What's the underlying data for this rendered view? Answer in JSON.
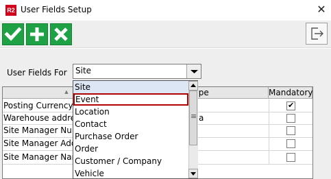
{
  "window": {
    "app_icon_text": "R2",
    "title": "User Fields Setup",
    "close_glyph": "✕"
  },
  "toolbar": {
    "buttons": [
      {
        "name": "save",
        "icon": "check-icon"
      },
      {
        "name": "add",
        "icon": "plus-icon"
      },
      {
        "name": "delete",
        "icon": "x-icon"
      }
    ],
    "exit_icon": "exit-icon"
  },
  "filter": {
    "label": "User Fields For",
    "selected": "Site"
  },
  "table": {
    "headers": {
      "name": "",
      "type": "Type",
      "mandatory": "Mandatory"
    },
    "sort_indicator": "▲",
    "rows": [
      {
        "name": "Posting Currency",
        "type": "",
        "mandatory": true
      },
      {
        "name": "Warehouse address",
        "type": "a",
        "mandatory": false
      },
      {
        "name": "Site Manager Num",
        "type": "",
        "mandatory": false
      },
      {
        "name": "Site Manager Addr",
        "type": "",
        "mandatory": false
      },
      {
        "name": "Site Manager Nam",
        "type": "",
        "mandatory": false
      }
    ]
  },
  "dropdown": {
    "options": [
      "Site",
      "Event",
      "Location",
      "Contact",
      "Purchase Order",
      "Order",
      "Customer / Company",
      "Vehicle"
    ],
    "highlighted_index": 0,
    "outlined_index": 1,
    "scroll_grip": "≡"
  },
  "colors": {
    "toolbar_button": "#1fa146",
    "highlight": "#dce6f4",
    "outline": "#b00000"
  }
}
